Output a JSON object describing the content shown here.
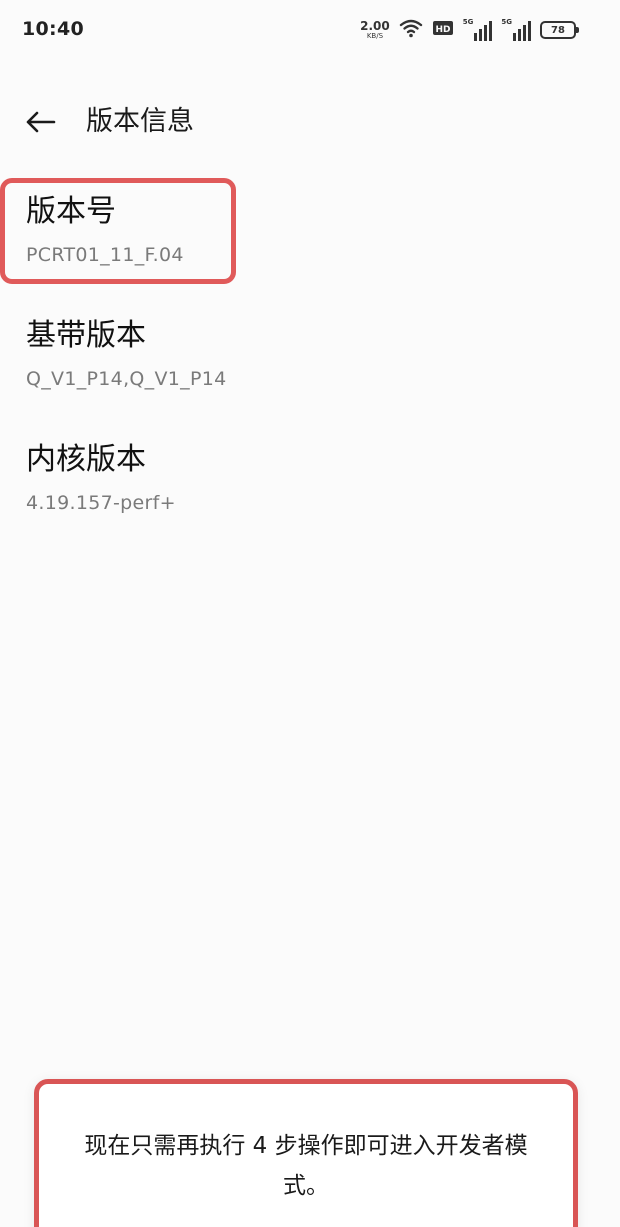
{
  "status_bar": {
    "time": "10:40",
    "net_speed_value": "2.00",
    "net_speed_unit": "KB/S",
    "hd_badge": "HD",
    "signal1_label": "5G",
    "signal2_label": "5G",
    "battery": "78"
  },
  "header": {
    "title": "版本信息"
  },
  "items": [
    {
      "title": "版本号",
      "value": "PCRT01_11_F.04"
    },
    {
      "title": "基带版本",
      "value": "Q_V1_P14,Q_V1_P14"
    },
    {
      "title": "内核版本",
      "value": "4.19.157-perf+"
    }
  ],
  "toast": {
    "message": "现在只需再执行 4 步操作即可进入开发者模式。"
  },
  "colors": {
    "highlight": "#e05a5a",
    "background": "#fbfbfb",
    "secondary_text": "#7a7a7a"
  }
}
